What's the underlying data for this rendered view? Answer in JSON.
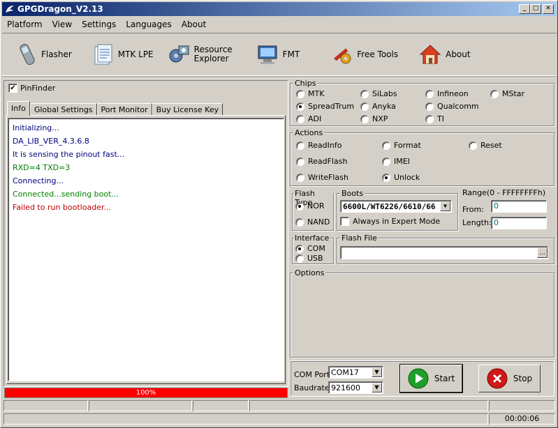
{
  "title": "GPGDragon_V2.13",
  "menu": [
    "Platform",
    "View",
    "Settings",
    "Languages",
    "About"
  ],
  "toolbar": {
    "flasher": "Flasher",
    "mtklpe": "MTK LPE",
    "resource1": "Resource",
    "resource2": "Explorer",
    "fmt": "FMT",
    "freetools": "Free Tools",
    "about": "About"
  },
  "pinfinder": "PinFinder",
  "tabs": [
    "Info",
    "Global Settings",
    "Port Monitor",
    "Buy License Key"
  ],
  "log": [
    {
      "text": "Initializing...",
      "color": "#000080"
    },
    {
      "text": "DA_LIB_VER_4.3.6.8",
      "color": "#000080"
    },
    {
      "text": "It is sensing the pinout fast...",
      "color": "#000080"
    },
    {
      "text": "RXD=4  TXD=3",
      "color": "#008000"
    },
    {
      "text": "Connecting...",
      "color": "#000080"
    },
    {
      "text": "Connected...sending boot...",
      "color": "#008000"
    },
    {
      "text": "Failed to run bootloader...",
      "color": "#c00000"
    }
  ],
  "progress": "100%",
  "chips": {
    "title": "Chips",
    "items": [
      "MTK",
      "SiLabs",
      "Infineon",
      "MStar",
      "SpreadTrum",
      "Anyka",
      "Qualcomm",
      "ADI",
      "NXP",
      "TI"
    ],
    "selected": "SpreadTrum"
  },
  "actions": {
    "title": "Actions",
    "items": [
      "ReadInfo",
      "Format",
      "Reset",
      "ReadFlash",
      "IMEI",
      "WriteFlash",
      "Unlock"
    ],
    "selected": "Unlock"
  },
  "flashtype": {
    "title": "Flash Type",
    "nor": "NOR",
    "nand": "NAND",
    "selected": "NOR"
  },
  "boots": {
    "title": "Boots",
    "value": "6600L/WT6226/6610/66",
    "expert": "Always in Expert Mode"
  },
  "range": {
    "title": "Range(0 - FFFFFFFFh)",
    "from_label": "From:",
    "from": "0",
    "length_label": "Length:",
    "length": "0"
  },
  "interface": {
    "title": "Interface",
    "com": "COM",
    "usb": "USB",
    "selected": "COM"
  },
  "flashfile": {
    "title": "Flash File",
    "value": "",
    "browse": "..."
  },
  "options": {
    "title": "Options"
  },
  "port": {
    "com_label": "COM Port",
    "com": "COM17",
    "baud_label": "Baudrate",
    "baud": "921600"
  },
  "start": "Start",
  "stop": "Stop",
  "statusbar": {
    "time": "00:00:06"
  },
  "colors": {
    "title_start": "#0a246a",
    "title_end": "#a6caf0",
    "progress": "#ff0000"
  }
}
